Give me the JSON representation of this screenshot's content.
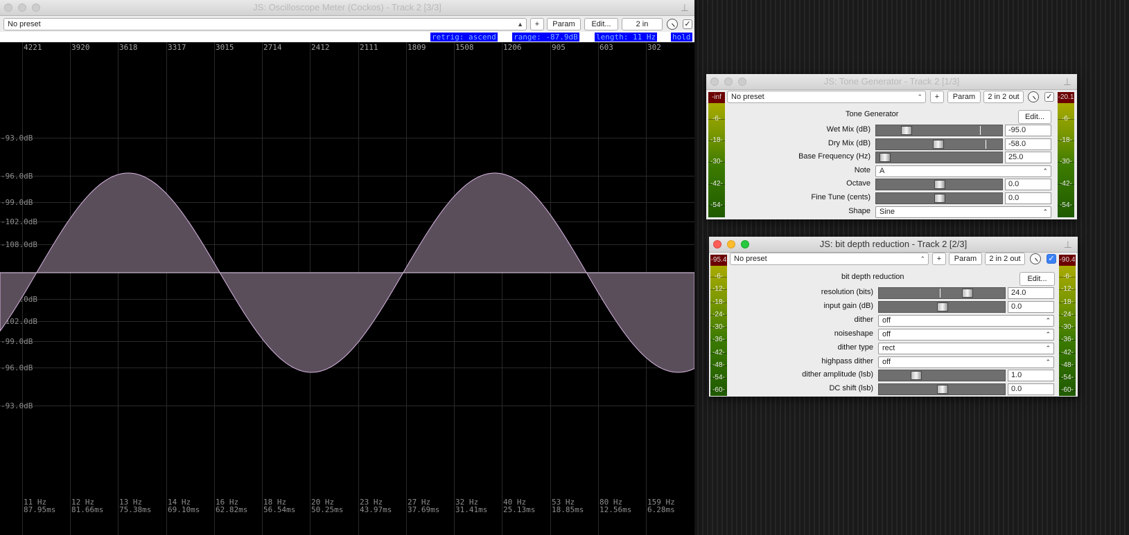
{
  "colors": {
    "accent": "#0000ff",
    "meter_clip": "#6c0000",
    "wave_fill": "#5b4e5b",
    "wave_stroke": "#d9b7e3"
  },
  "scope": {
    "title": "JS: Oscilloscope Meter (Cockos) - Track 2 [3/3]",
    "preset": "No preset",
    "plus": "+",
    "param": "Param",
    "edit": "Edit...",
    "io": "2 in",
    "enabled_check": "✓",
    "pin_icon": "⊥",
    "status": {
      "retrig": "retrig: ascend",
      "range": "range: -87.9dB",
      "length": "length: 11 Hz",
      "hold": "hold"
    },
    "top_labels": [
      "4221",
      "3920",
      "3618",
      "3317",
      "3015",
      "2714",
      "2412",
      "2111",
      "1809",
      "1508",
      "1206",
      "905",
      "603",
      "302"
    ],
    "db_labels": [
      "-93.0dB",
      "-96.0dB",
      "-99.0dB",
      "-102.0dB",
      "-108.0dB",
      "-108.0dB",
      "-102.0dB",
      "-99.0dB",
      "-96.0dB",
      "-93.0dB"
    ],
    "bottom_hz": [
      "11 Hz",
      "12 Hz",
      "13 Hz",
      "14 Hz",
      "16 Hz",
      "18 Hz",
      "20 Hz",
      "23 Hz",
      "27 Hz",
      "32 Hz",
      "40 Hz",
      "53 Hz",
      "80 Hz",
      "159 Hz"
    ],
    "bottom_ms": [
      "87.95ms",
      "81.66ms",
      "75.38ms",
      "69.10ms",
      "62.82ms",
      "56.54ms",
      "50.25ms",
      "43.97ms",
      "37.69ms",
      "31.41ms",
      "25.13ms",
      "18.85ms",
      "12.56ms",
      "6.28ms"
    ]
  },
  "tone": {
    "title": "JS: Tone Generator - Track 2 [1/3]",
    "preset": "No preset",
    "plus": "+",
    "param": "Param",
    "io": "2 in 2 out",
    "enabled_check": "✓",
    "pin_icon": "⊥",
    "plugin_name": "Tone Generator",
    "edit": "Edit...",
    "meter_left": {
      "header": "-inf",
      "ticks": [
        "-6-",
        "-18-",
        "-30-",
        "-42-",
        "-54-"
      ]
    },
    "meter_right": {
      "header": "-20.1",
      "ticks": [
        "-6-",
        "-18-",
        "-30-",
        "-42-",
        "-54-"
      ]
    },
    "params": [
      {
        "label": "Wet Mix (dB)",
        "kind": "slider",
        "value": "-95.0",
        "pos": 0.21
      },
      {
        "label": "Dry Mix (dB)",
        "kind": "slider",
        "value": "-58.0",
        "pos": 0.49
      },
      {
        "label": "Base Frequency (Hz)",
        "kind": "slider",
        "value": "25.0",
        "pos": 0.02
      },
      {
        "label": "Note",
        "kind": "combo",
        "value": "A"
      },
      {
        "label": "Octave",
        "kind": "slider",
        "value": "0.0",
        "pos": 0.5
      },
      {
        "label": "Fine Tune (cents)",
        "kind": "slider",
        "value": "0.0",
        "pos": 0.5
      },
      {
        "label": "Shape",
        "kind": "combo",
        "value": "Sine"
      }
    ]
  },
  "bitdepth": {
    "title": "JS: bit depth reduction - Track 2 [2/3]",
    "preset": "No preset",
    "plus": "+",
    "param": "Param",
    "io": "2 in 2 out",
    "enabled_check": "✓",
    "pin_icon": "⊥",
    "plugin_name": "bit depth reduction",
    "edit": "Edit...",
    "meter_left": {
      "header": "-95.4",
      "ticks": [
        "-6-",
        "-12-",
        "-18-",
        "-24-",
        "-30-",
        "-36-",
        "-42-",
        "-48-",
        "-54-",
        "-60-"
      ]
    },
    "meter_right": {
      "header": "-90.4",
      "ticks": [
        "-6-",
        "-12-",
        "-18-",
        "-24-",
        "-30-",
        "-36-",
        "-42-",
        "-48-",
        "-54-",
        "-60-"
      ]
    },
    "params": [
      {
        "label": "resolution (bits)",
        "kind": "slider",
        "value": "24.0",
        "pos": 0.72
      },
      {
        "label": "input gain (dB)",
        "kind": "slider",
        "value": "0.0",
        "pos": 0.5
      },
      {
        "label": "dither",
        "kind": "combo",
        "value": "off"
      },
      {
        "label": "noiseshape",
        "kind": "combo",
        "value": "off"
      },
      {
        "label": "dither type",
        "kind": "combo",
        "value": "rect"
      },
      {
        "label": "highpass dither",
        "kind": "combo",
        "value": "off"
      },
      {
        "label": "dither amplitude (lsb)",
        "kind": "slider",
        "value": "1.0",
        "pos": 0.27
      },
      {
        "label": "DC shift (lsb)",
        "kind": "slider",
        "value": "0.0",
        "pos": 0.5
      }
    ]
  }
}
